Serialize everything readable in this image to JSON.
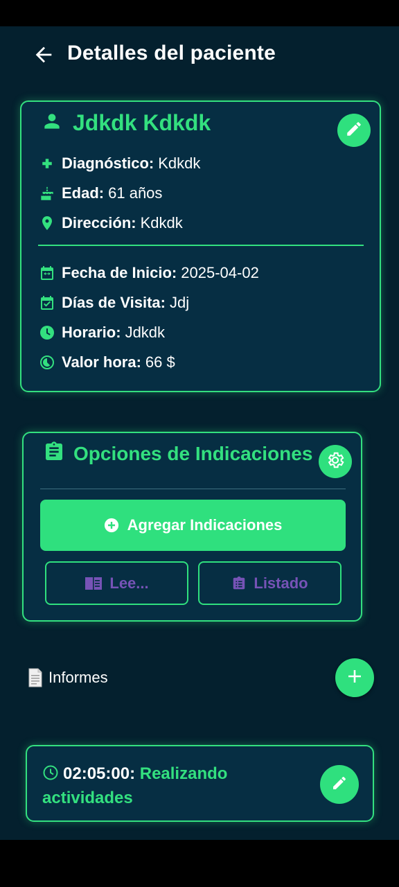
{
  "header": {
    "title": "Detalles del paciente"
  },
  "patient": {
    "name": "Jdkdk Kdkdk",
    "details": [
      {
        "icon": "plus-icon",
        "label": "Diagnóstico:",
        "value": "Kdkdk"
      },
      {
        "icon": "cake-icon",
        "label": "Edad:",
        "value": "61 años"
      },
      {
        "icon": "location-pin-icon",
        "label": "Dirección:",
        "value": "Kdkdk"
      }
    ],
    "schedule": [
      {
        "icon": "calendar-range-icon",
        "label": "Fecha de Inicio:",
        "value": "2025-04-02"
      },
      {
        "icon": "calendar-check-icon",
        "label": "Días de Visita:",
        "value": "Jdj"
      },
      {
        "icon": "clock-icon",
        "label": "Horario:",
        "value": "Jdkdk"
      },
      {
        "icon": "timelapse-icon",
        "label": "Valor hora:",
        "value": "66 $"
      }
    ]
  },
  "options": {
    "title": "Opciones de Indicaciones",
    "add_label": "Agregar Indicaciones",
    "read_label": "Lee...",
    "list_label": "Listado"
  },
  "reports": {
    "section_label": "Informes",
    "items": [
      {
        "time": "02:05:00:",
        "text": "Realizando actividades"
      }
    ]
  },
  "colors": {
    "accent": "#2fe07e",
    "background": "#04202e",
    "card": "#062e43",
    "muted_purple": "#7653b6"
  }
}
